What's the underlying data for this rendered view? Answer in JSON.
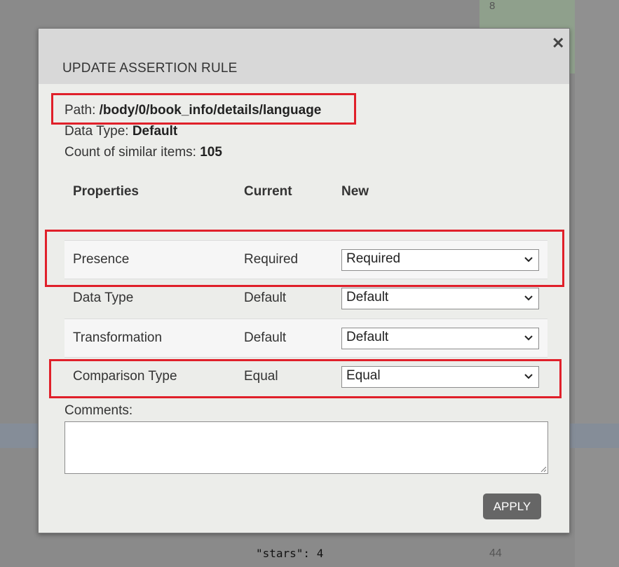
{
  "background": {
    "top_number": "8",
    "code_line": "\"stars\": 4",
    "bottom_number": "44"
  },
  "modal": {
    "title": "UPDATE ASSERTION RULE",
    "close_icon": "close-icon",
    "path_label": "Path: ",
    "path_value": "/body/0/book_info/details/language",
    "datatype_label": "Data Type: ",
    "datatype_value": "Default",
    "count_label": "Count of similar items: ",
    "count_value": "105",
    "table": {
      "headers": [
        "Properties",
        "Current",
        "New"
      ],
      "rows": [
        {
          "property": "Presence",
          "current": "Required",
          "new": "Required"
        },
        {
          "property": "Data Type",
          "current": "Default",
          "new": "Default"
        },
        {
          "property": "Transformation",
          "current": "Default",
          "new": "Default"
        },
        {
          "property": "Comparison Type",
          "current": "Equal",
          "new": "Equal"
        }
      ]
    },
    "comments_label": "Comments:",
    "comments_value": "",
    "apply_label": "APPLY"
  },
  "colors": {
    "highlight": "#e0202a",
    "button": "#666666"
  }
}
